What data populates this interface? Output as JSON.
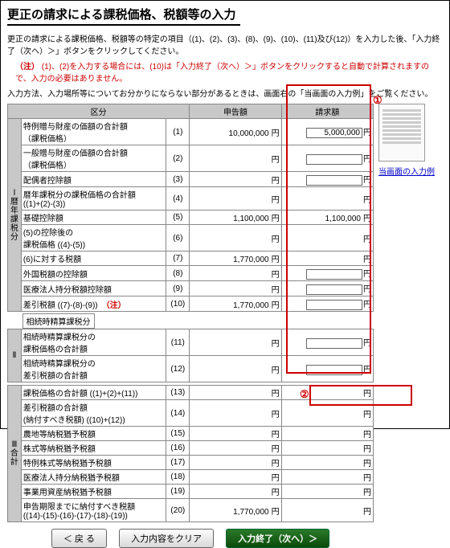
{
  "title": "更正の請求による課税価格、税額等の入力",
  "intro": "更正の請求による課税価格、税額等の特定の項目（(1)、(2)、(3)、(8)、(9)、(10)、(11)及び(12)）を入力した後、「入力終了（次へ）＞」ボタンをクリックしてください。",
  "note_label": "（注）",
  "note_text": "(1)、(2)を入力する場合には、(10)は「入力終了（次へ）＞」ボタンをクリックすると自動で計算されますので、入力の必要はありません。",
  "hint": "入力方法、入力場所等についてお分かりにならない部分があるときは、画面右の「当画面の入力例」をご覧ください。",
  "col_kubun": "区分",
  "col_shinkoku": "申告額",
  "col_seikyu": "請求額",
  "side_link": "当画面の入力例",
  "vlabel1": "Ⅰ暦年課税分",
  "vlabel2": "Ⅱ",
  "vlabel3": "Ⅲ合計",
  "block2_title": "相続時精算課税分",
  "rows1": [
    {
      "name": "特例贈与財産の価額の合計額\n（課税価格）",
      "num": "(1)",
      "a": "10,000,000",
      "b": "5,000,000",
      "b_input": true
    },
    {
      "name": "一般贈与財産の価額の合計額\n（課税価格）",
      "num": "(2)",
      "a": "",
      "b": "",
      "b_input": true
    },
    {
      "name": "配偶者控除額",
      "num": "(3)",
      "a": "",
      "b": "",
      "b_input": true
    },
    {
      "name": "暦年課税分の課税価格の合計額\n((1)+(2)-(3))",
      "num": "(4)",
      "a": "",
      "b": ""
    },
    {
      "name": "基礎控除額",
      "num": "(5)",
      "a": "1,100,000",
      "b": "1,100,000"
    },
    {
      "name": "(5)の控除後の\n課税価格 ((4)-(5))",
      "num": "(6)",
      "a": "",
      "b": ""
    },
    {
      "name": "(6)に対する税額",
      "num": "(7)",
      "a": "1,770,000",
      "b": ""
    },
    {
      "name": "外国税額の控除額",
      "num": "(8)",
      "a": "",
      "b": "",
      "b_input": true
    },
    {
      "name": "医療法人持分税額控除額",
      "num": "(9)",
      "a": "",
      "b": "",
      "b_input": true
    },
    {
      "name": "差引税額 ((7)-(8)-(9))　（注）",
      "num": "(10)",
      "a": "1,770,000",
      "b": "",
      "b_input": true,
      "name_red": true
    }
  ],
  "rows2": [
    {
      "name": "相続時精算課税分の\n課税価格の合計額",
      "num": "(11)",
      "a": "",
      "b": "",
      "b_input": true
    },
    {
      "name": "相続時精算課税分の\n差引税額の合計額",
      "num": "(12)",
      "a": "",
      "b": "",
      "b_input": true
    }
  ],
  "rows3": [
    {
      "name": "課税価格の合計額 ((1)+(2)+(11))",
      "num": "(13)",
      "a": "",
      "b": ""
    },
    {
      "name": "差引税額の合計額\n(納付すべき税額) ((10)+(12))",
      "num": "(14)",
      "a": "",
      "b": ""
    },
    {
      "name": "農地等納税猶予税額",
      "num": "(15)",
      "a": "",
      "b": ""
    },
    {
      "name": "株式等納税猶予税額",
      "num": "(16)",
      "a": "",
      "b": ""
    },
    {
      "name": "特例株式等納税猶予税額",
      "num": "(17)",
      "a": "",
      "b": ""
    },
    {
      "name": "医療法人持分納税猶予税額",
      "num": "(18)",
      "a": "",
      "b": ""
    },
    {
      "name": "事業用資産納税猶予税額",
      "num": "(19)",
      "a": "",
      "b": ""
    },
    {
      "name": "申告期限までに納付すべき税額\n((14)-(15)-(16)-(17)-(18)-(19))",
      "num": "(20)",
      "a": "1,770,000",
      "b": ""
    }
  ],
  "btn_back": "＜ 戻 る",
  "btn_clear": "入力内容をクリア",
  "btn_next": "入力終了（次へ）＞",
  "marker1": "①",
  "marker2": "②"
}
